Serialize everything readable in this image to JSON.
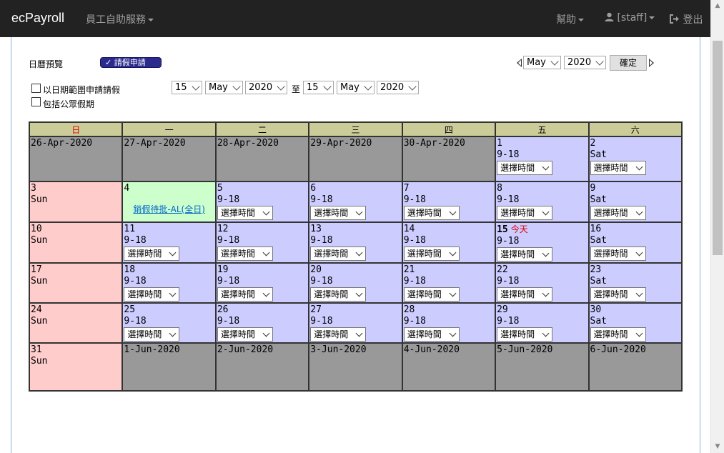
{
  "nav": {
    "brand": "ecPayroll",
    "self_service": "員工自助服務",
    "help": "幫助",
    "user": "[staff]",
    "logout": "登出"
  },
  "toolbar": {
    "calendar_preview": "日曆預覽",
    "leave_apply": "請假申請",
    "month": "May",
    "year": "2020",
    "confirm": "確定",
    "date_range_label": "以日期範圍申請請假",
    "include_holidays_label": "包括公眾假期",
    "range_from_day": "15",
    "range_from_month": "May",
    "range_from_year": "2020",
    "range_to_label": "至",
    "range_to_day": "15",
    "range_to_month": "May",
    "range_to_year": "2020"
  },
  "calendar": {
    "weekdays": [
      "日",
      "一",
      "二",
      "三",
      "四",
      "五",
      "六"
    ],
    "select_time": "選擇時間",
    "today_label": "今天",
    "weeks": [
      [
        {
          "type": "grey",
          "lines": [
            "26-Apr-2020"
          ]
        },
        {
          "type": "grey",
          "lines": [
            "27-Apr-2020"
          ]
        },
        {
          "type": "grey",
          "lines": [
            "28-Apr-2020"
          ]
        },
        {
          "type": "grey",
          "lines": [
            "29-Apr-2020"
          ]
        },
        {
          "type": "grey",
          "lines": [
            "30-Apr-2020"
          ]
        },
        {
          "type": "purple",
          "lines": [
            "1",
            "9-18"
          ],
          "select": true
        },
        {
          "type": "purple",
          "lines": [
            "2",
            "Sat"
          ],
          "select": true
        }
      ],
      [
        {
          "type": "pink",
          "lines": [
            "3",
            "Sun"
          ]
        },
        {
          "type": "green",
          "lines": [
            "4"
          ],
          "link": "銷假待批-AL(全日)"
        },
        {
          "type": "purple",
          "lines": [
            "5",
            "9-18"
          ],
          "select": true
        },
        {
          "type": "purple",
          "lines": [
            "6",
            "9-18"
          ],
          "select": true
        },
        {
          "type": "purple",
          "lines": [
            "7",
            "9-18"
          ],
          "select": true
        },
        {
          "type": "purple",
          "lines": [
            "8",
            "9-18"
          ],
          "select": true
        },
        {
          "type": "purple",
          "lines": [
            "9",
            "Sat"
          ],
          "select": true
        }
      ],
      [
        {
          "type": "pink",
          "lines": [
            "10",
            "Sun"
          ]
        },
        {
          "type": "purple",
          "lines": [
            "11",
            "9-18"
          ],
          "select": true
        },
        {
          "type": "purple",
          "lines": [
            "12",
            "9-18"
          ],
          "select": true
        },
        {
          "type": "purple",
          "lines": [
            "13",
            "9-18"
          ],
          "select": true
        },
        {
          "type": "purple",
          "lines": [
            "14",
            "9-18"
          ],
          "select": true
        },
        {
          "type": "purple",
          "lines": [
            "15",
            "9-18"
          ],
          "select": true,
          "today": true
        },
        {
          "type": "purple",
          "lines": [
            "16",
            "Sat"
          ],
          "select": true
        }
      ],
      [
        {
          "type": "pink",
          "lines": [
            "17",
            "Sun"
          ]
        },
        {
          "type": "purple",
          "lines": [
            "18",
            "9-18"
          ],
          "select": true
        },
        {
          "type": "purple",
          "lines": [
            "19",
            "9-18"
          ],
          "select": true
        },
        {
          "type": "purple",
          "lines": [
            "20",
            "9-18"
          ],
          "select": true
        },
        {
          "type": "purple",
          "lines": [
            "21",
            "9-18"
          ],
          "select": true
        },
        {
          "type": "purple",
          "lines": [
            "22",
            "9-18"
          ],
          "select": true
        },
        {
          "type": "purple",
          "lines": [
            "23",
            "Sat"
          ],
          "select": true
        }
      ],
      [
        {
          "type": "pink",
          "lines": [
            "24",
            "Sun"
          ]
        },
        {
          "type": "purple",
          "lines": [
            "25",
            "9-18"
          ],
          "select": true
        },
        {
          "type": "purple",
          "lines": [
            "26",
            "9-18"
          ],
          "select": true
        },
        {
          "type": "purple",
          "lines": [
            "27",
            "9-18"
          ],
          "select": true
        },
        {
          "type": "purple",
          "lines": [
            "28",
            "9-18"
          ],
          "select": true
        },
        {
          "type": "purple",
          "lines": [
            "29",
            "9-18"
          ],
          "select": true
        },
        {
          "type": "purple",
          "lines": [
            "30",
            "Sat"
          ],
          "select": true
        }
      ],
      [
        {
          "type": "pink",
          "lines": [
            "31",
            "Sun"
          ]
        },
        {
          "type": "grey",
          "lines": [
            "1-Jun-2020"
          ]
        },
        {
          "type": "grey",
          "lines": [
            "2-Jun-2020"
          ]
        },
        {
          "type": "grey",
          "lines": [
            "3-Jun-2020"
          ]
        },
        {
          "type": "grey",
          "lines": [
            "4-Jun-2020"
          ]
        },
        {
          "type": "grey",
          "lines": [
            "5-Jun-2020"
          ]
        },
        {
          "type": "grey",
          "lines": [
            "6-Jun-2020"
          ]
        }
      ]
    ]
  }
}
